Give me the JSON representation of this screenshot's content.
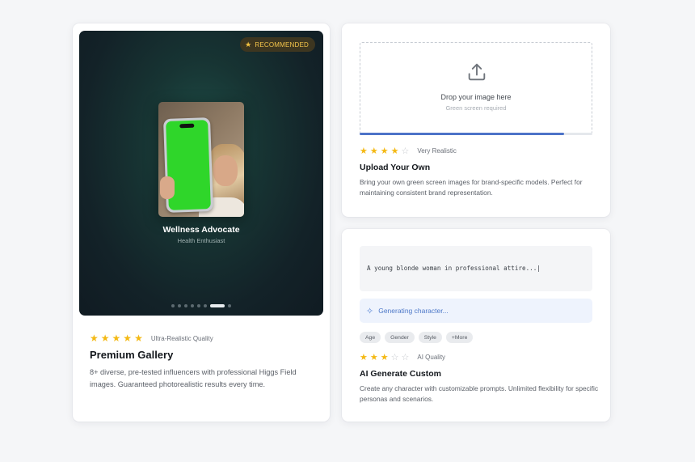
{
  "premium": {
    "badge": "RECOMMENDED",
    "badge_icon": "star-icon",
    "influencer_name": "Wellness Advocate",
    "influencer_role": "Health Enthusiast",
    "carousel": {
      "count": 8,
      "active_index": 6
    },
    "rating": {
      "stars": 5,
      "max": 5
    },
    "quality_label": "Ultra-Realistic Quality",
    "title": "Premium Gallery",
    "description": "8+ diverse, pre-tested influencers with professional Higgs Field images. Guaranteed photorealistic results every time."
  },
  "upload": {
    "upload_icon": "upload-icon",
    "drop_title": "Drop your image here",
    "drop_subtitle": "Green screen required",
    "progress_fraction": 0.88,
    "rating": {
      "stars": 4,
      "max": 5
    },
    "quality_label": "Very Realistic",
    "title": "Upload Your Own",
    "description": "Bring your own green screen images for brand-specific models. Perfect for maintaining consistent brand representation."
  },
  "ai": {
    "prompt_text": "A young blonde woman in professional attire...|",
    "generating_text": "Generating character...",
    "chips": [
      "Age",
      "Gender",
      "Style",
      "+More"
    ],
    "rating": {
      "stars": 3,
      "max": 5
    },
    "quality_label": "AI Quality",
    "title": "AI Generate Custom",
    "description": "Create any character with customizable prompts. Unlimited flexibility for specific personas and scenarios."
  },
  "colors": {
    "accent_blue": "#4d73c8",
    "star_gold": "#f4b914",
    "phone_green": "#2fd62a"
  }
}
